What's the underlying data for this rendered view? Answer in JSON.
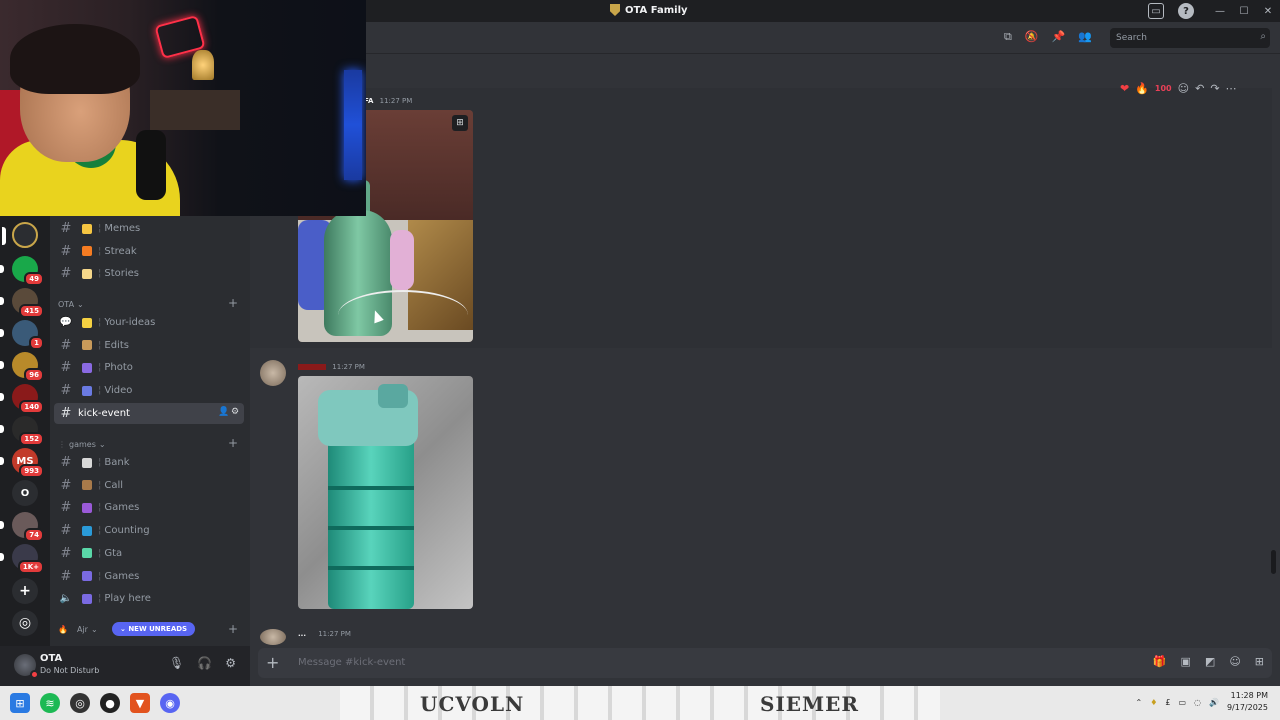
{
  "window": {
    "title": "OTA Family"
  },
  "header": {
    "search_placeholder": "Search"
  },
  "rail": {
    "servers": [
      {
        "label": "",
        "badge": "",
        "color": "#2b2d31",
        "active": true,
        "pip": true
      },
      {
        "label": "",
        "badge": "49",
        "color": "#19a84a",
        "pip": true
      },
      {
        "label": "",
        "badge": "415",
        "color": "#5a4a3a",
        "pip": true
      },
      {
        "label": "",
        "badge": "1",
        "color": "#3a5a78",
        "pip": true
      },
      {
        "label": "",
        "badge": "96",
        "color": "#b88a2a",
        "pip": true
      },
      {
        "label": "",
        "badge": "140",
        "color": "#8a1a1a",
        "pip": true
      },
      {
        "label": "",
        "badge": "152",
        "color": "#2a2a2a",
        "pip": true
      },
      {
        "label": "MS",
        "badge": "993",
        "color": "#c23a2a",
        "pip": true
      },
      {
        "label": "O",
        "badge": "",
        "color": "#2b2d31",
        "pip": false
      },
      {
        "label": "",
        "badge": "74",
        "color": "#6a5a5a",
        "pip": true
      },
      {
        "label": "",
        "badge": "1K+",
        "color": "#3a3a4a",
        "pip": true
      }
    ]
  },
  "sidebar": {
    "top_channels": [
      {
        "label": "Memes",
        "emoji_color": "#f5c542"
      },
      {
        "label": "Streak",
        "emoji_color": "#f57c22"
      },
      {
        "label": "Stories",
        "emoji_color": "#f5d78a"
      }
    ],
    "category_ota": "OTA",
    "ota_channels": [
      {
        "label": "Your-ideas",
        "emoji_color": "#f5d142",
        "icon": "forum"
      },
      {
        "label": "Edits",
        "emoji_color": "#c89a5a",
        "icon": "hash"
      },
      {
        "label": "Photo",
        "emoji_color": "#8a6ae2",
        "icon": "hash"
      },
      {
        "label": "Video",
        "emoji_color": "#6a7ae2",
        "icon": "hash"
      }
    ],
    "active_channel": "kick-event",
    "category_games": "games",
    "games_channels": [
      {
        "label": "Bank",
        "emoji_color": "#d8d8d8",
        "icon": "hash"
      },
      {
        "label": "Call",
        "emoji_color": "#a87a4a",
        "icon": "hash"
      },
      {
        "label": "Games",
        "emoji_color": "#9a5ad8",
        "icon": "hash"
      },
      {
        "label": "Counting",
        "emoji_color": "#2a9ad8",
        "icon": "hash"
      },
      {
        "label": "Gta",
        "emoji_color": "#5ad8a8",
        "icon": "hash"
      },
      {
        "label": "Games",
        "emoji_color": "#7a6ae2",
        "icon": "hash"
      },
      {
        "label": "Play here",
        "emoji_color": "#7a6ae2",
        "icon": "voice"
      }
    ],
    "category_ajr": "Ajr",
    "new_unreads": "NEW UNREADS"
  },
  "user": {
    "name": "OTA",
    "status": "Do Not Disturb"
  },
  "messages": [
    {
      "author": "FA",
      "time": "11:27 PM"
    },
    {
      "author": "",
      "time": "11:27 PM"
    },
    {
      "author": "...",
      "time": "11:27 PM"
    }
  ],
  "composer": {
    "placeholder": "Message #kick-event"
  },
  "taskbar": {
    "wallpaper_text_left": "UCVOLN",
    "wallpaper_text_right": "SIEMER",
    "time": "11:28 PM",
    "date": "9/17/2025"
  },
  "colors": {
    "accent": "#5865f2",
    "dnd": "#f23f43",
    "badge": "#e23b3b"
  }
}
